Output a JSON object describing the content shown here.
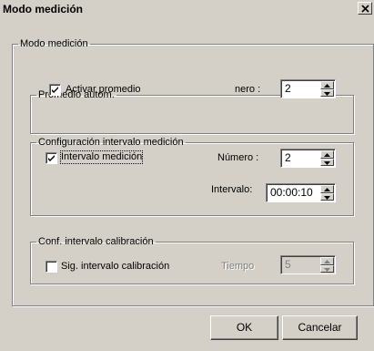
{
  "window": {
    "title": "Modo medición",
    "close_glyph": "✕"
  },
  "group_main": {
    "legend": "Modo medición"
  },
  "group_promedio": {
    "legend": "Promedio autom.",
    "checkbox_label": "Activar promedio",
    "checkbox_checked": true,
    "field_label": "nero :",
    "field_value": "2"
  },
  "group_config": {
    "legend": "Configuración intervalo medición",
    "checkbox_label": "Intervalo medición",
    "checkbox_checked": true,
    "numero_label": "Número :",
    "numero_value": "2",
    "intervalo_label": "Intervalo:",
    "intervalo_value": "00:00:10"
  },
  "group_calib": {
    "legend": "Conf. intervalo calibración",
    "checkbox_label": "Sig. intervalo calibración",
    "checkbox_checked": false,
    "tiempo_label": "Tiempo",
    "tiempo_value": "5"
  },
  "buttons": {
    "ok_label": "OK",
    "cancel_label": "Cancelar"
  },
  "icons": {
    "check": "checkmark-icon",
    "spin_up": "arrow-up-icon",
    "spin_down": "arrow-down-icon",
    "close": "close-icon"
  }
}
